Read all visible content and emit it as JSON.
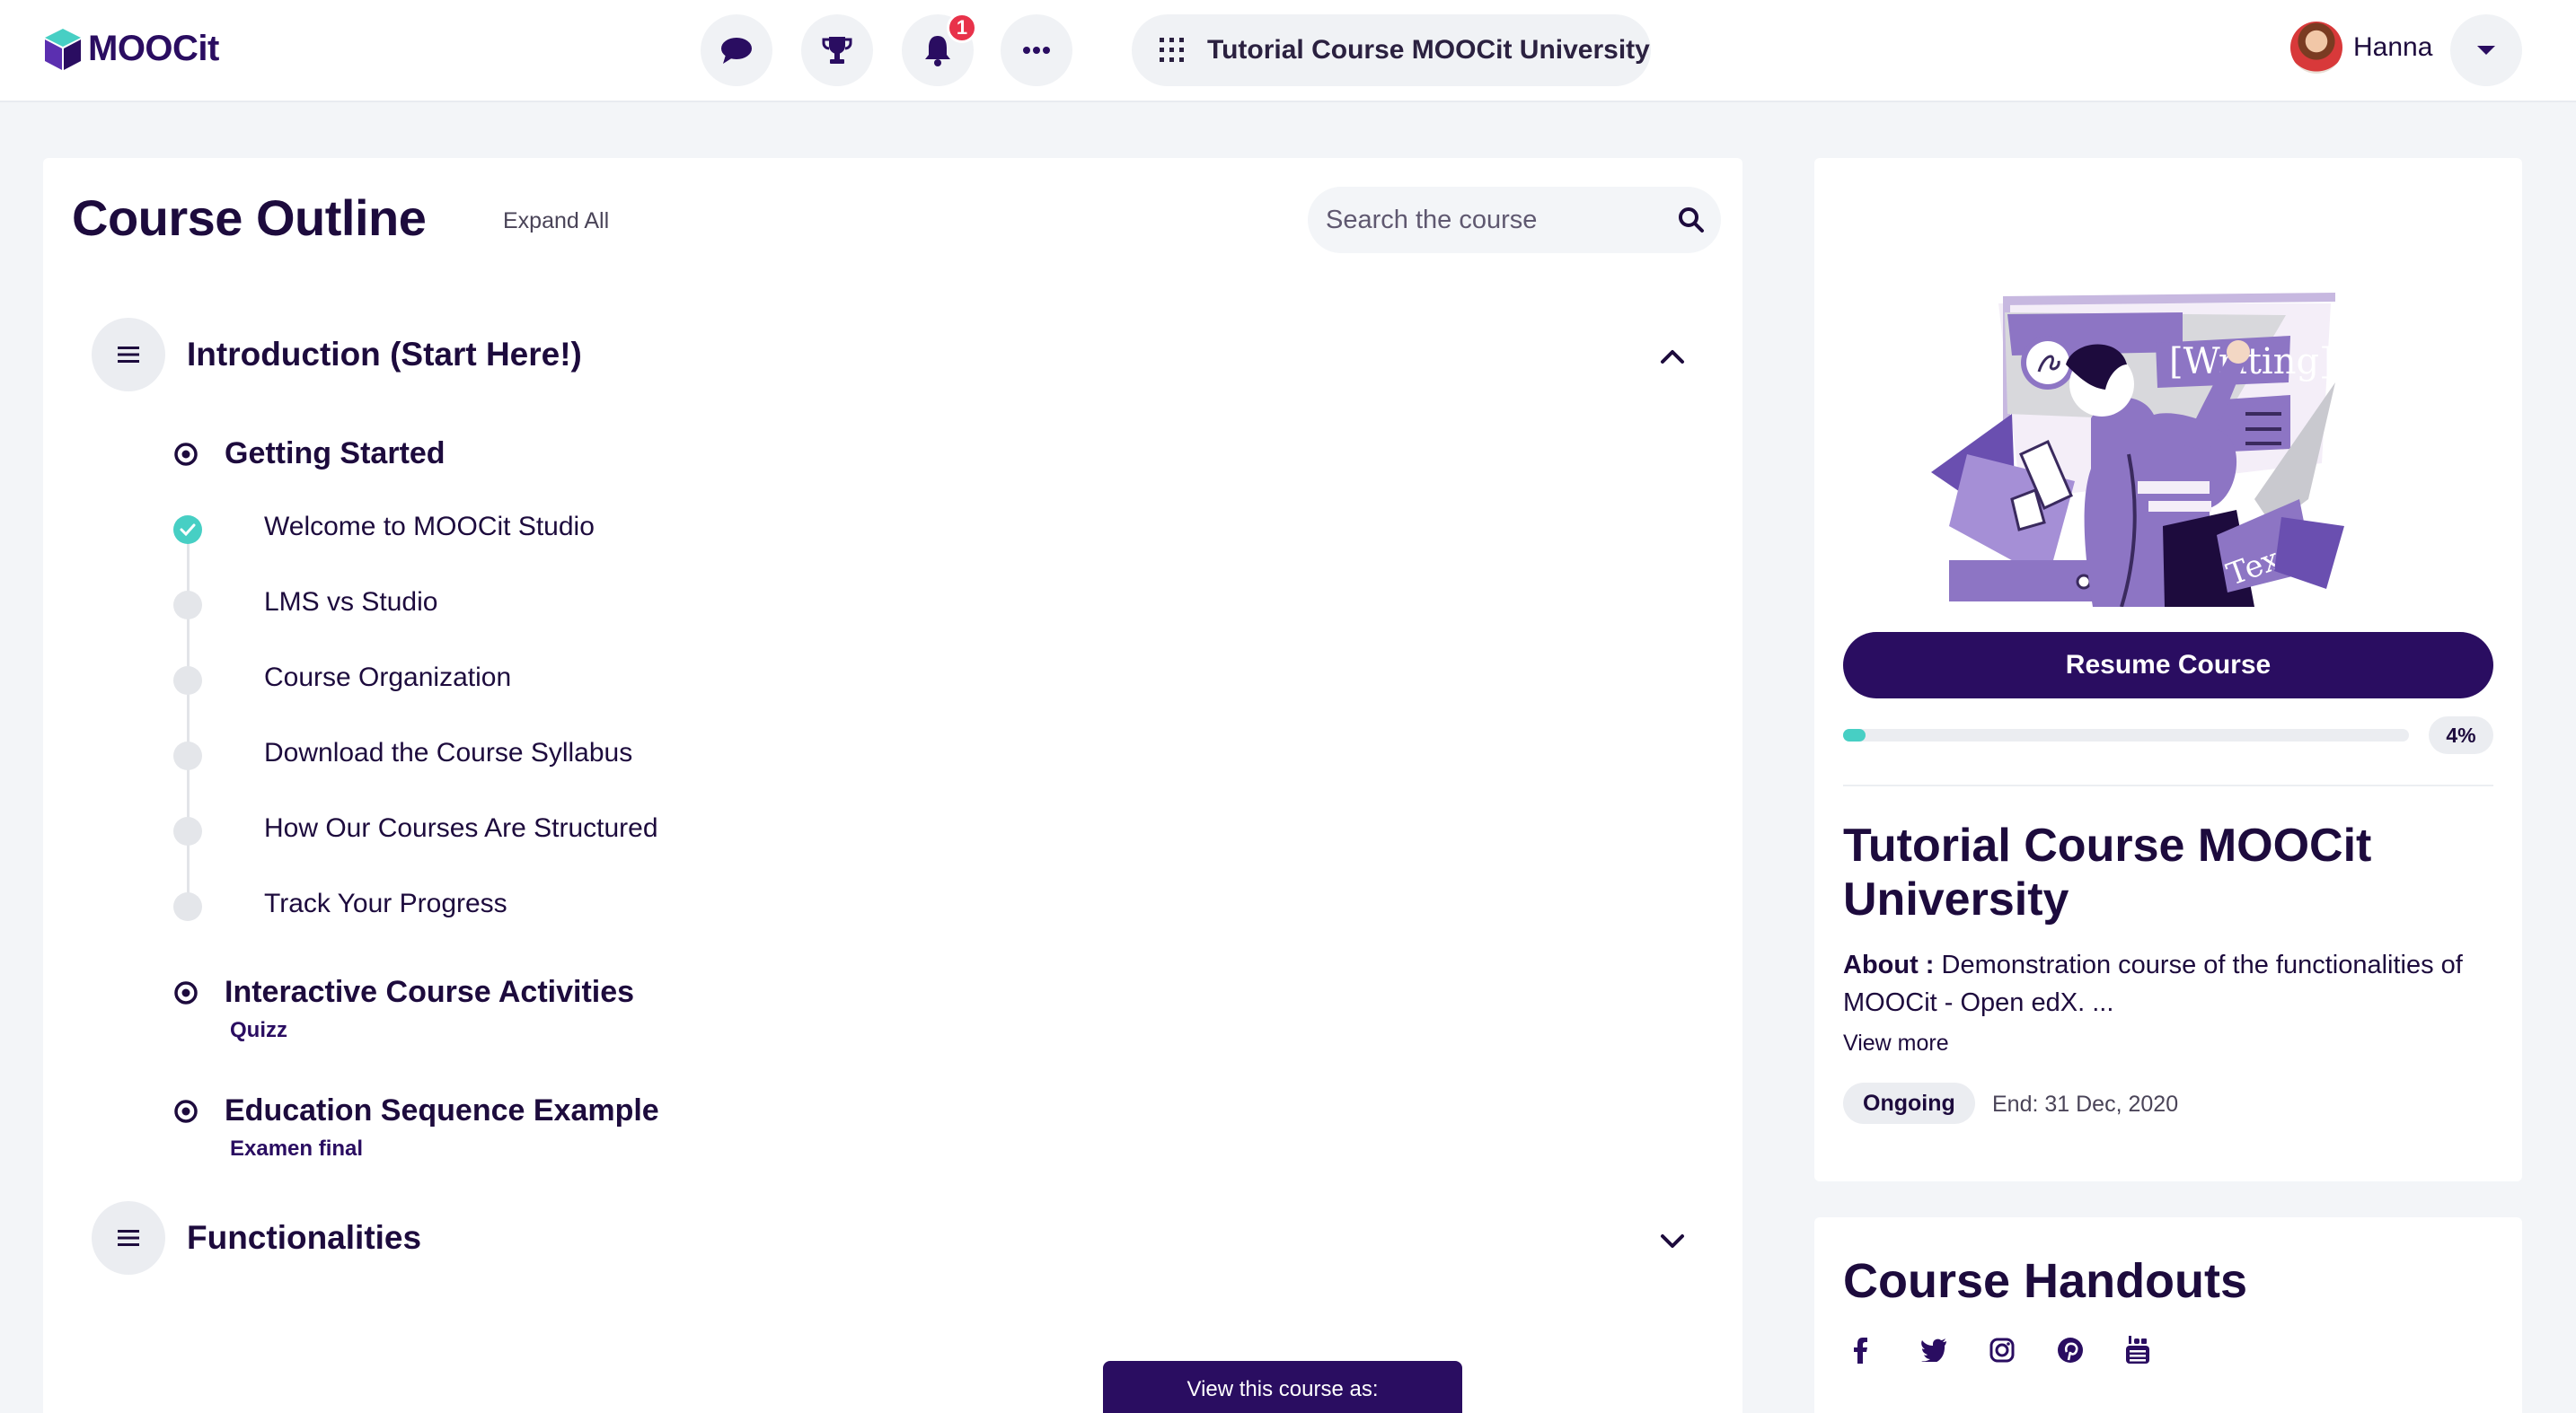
{
  "header": {
    "logo_text": "MOOCit",
    "notification_count": "1",
    "course_selector_label": "Tutorial Course MOOCit University",
    "user_name": "Hanna",
    "icons": [
      "chat-icon",
      "trophy-icon",
      "bell-icon",
      "more-icon",
      "apps-grid-icon",
      "chevron-down-icon"
    ]
  },
  "outline": {
    "title": "Course Outline",
    "expand_all": "Expand All",
    "search_placeholder": "Search the course",
    "sections": [
      {
        "label": "Introduction (Start Here!)",
        "expanded": true,
        "subsections": [
          {
            "label": "Getting Started",
            "units": [
              {
                "label": "Welcome to MOOCit Studio",
                "completed": true
              },
              {
                "label": "LMS vs Studio",
                "completed": false
              },
              {
                "label": "Course Organization",
                "completed": false
              },
              {
                "label": "Download the Course Syllabus",
                "completed": false
              },
              {
                "label": "How Our Courses Are Structured",
                "completed": false
              },
              {
                "label": "Track Your Progress",
                "completed": false
              }
            ]
          },
          {
            "label": "Interactive Course Activities",
            "note": "Quizz"
          },
          {
            "label": "Education Sequence Example",
            "note": "Examen final"
          }
        ]
      },
      {
        "label": "Functionalities",
        "expanded": false
      }
    ],
    "view_as_label": "View this course as:"
  },
  "sidebar": {
    "resume_label": "Resume Course",
    "progress_percent": 4,
    "progress_label": "4%",
    "course_title": "Tutorial Course MOOCit University",
    "about_label": "About :",
    "about_text": " Demonstration course of the functionalities of MOOCit - Open edX. ...",
    "view_more": "View more",
    "status": "Ongoing",
    "end_date": "End: 31 Dec, 2020",
    "handouts_title": "Course Handouts",
    "social_icons": [
      "facebook-icon",
      "twitter-icon",
      "instagram-icon",
      "pinterest-icon",
      "youtube-icon"
    ]
  },
  "colors": {
    "brand": "#2a0d61",
    "accent": "#47cfc4",
    "notification": "#e8324a",
    "illustration_purple": "#8d75c4"
  }
}
